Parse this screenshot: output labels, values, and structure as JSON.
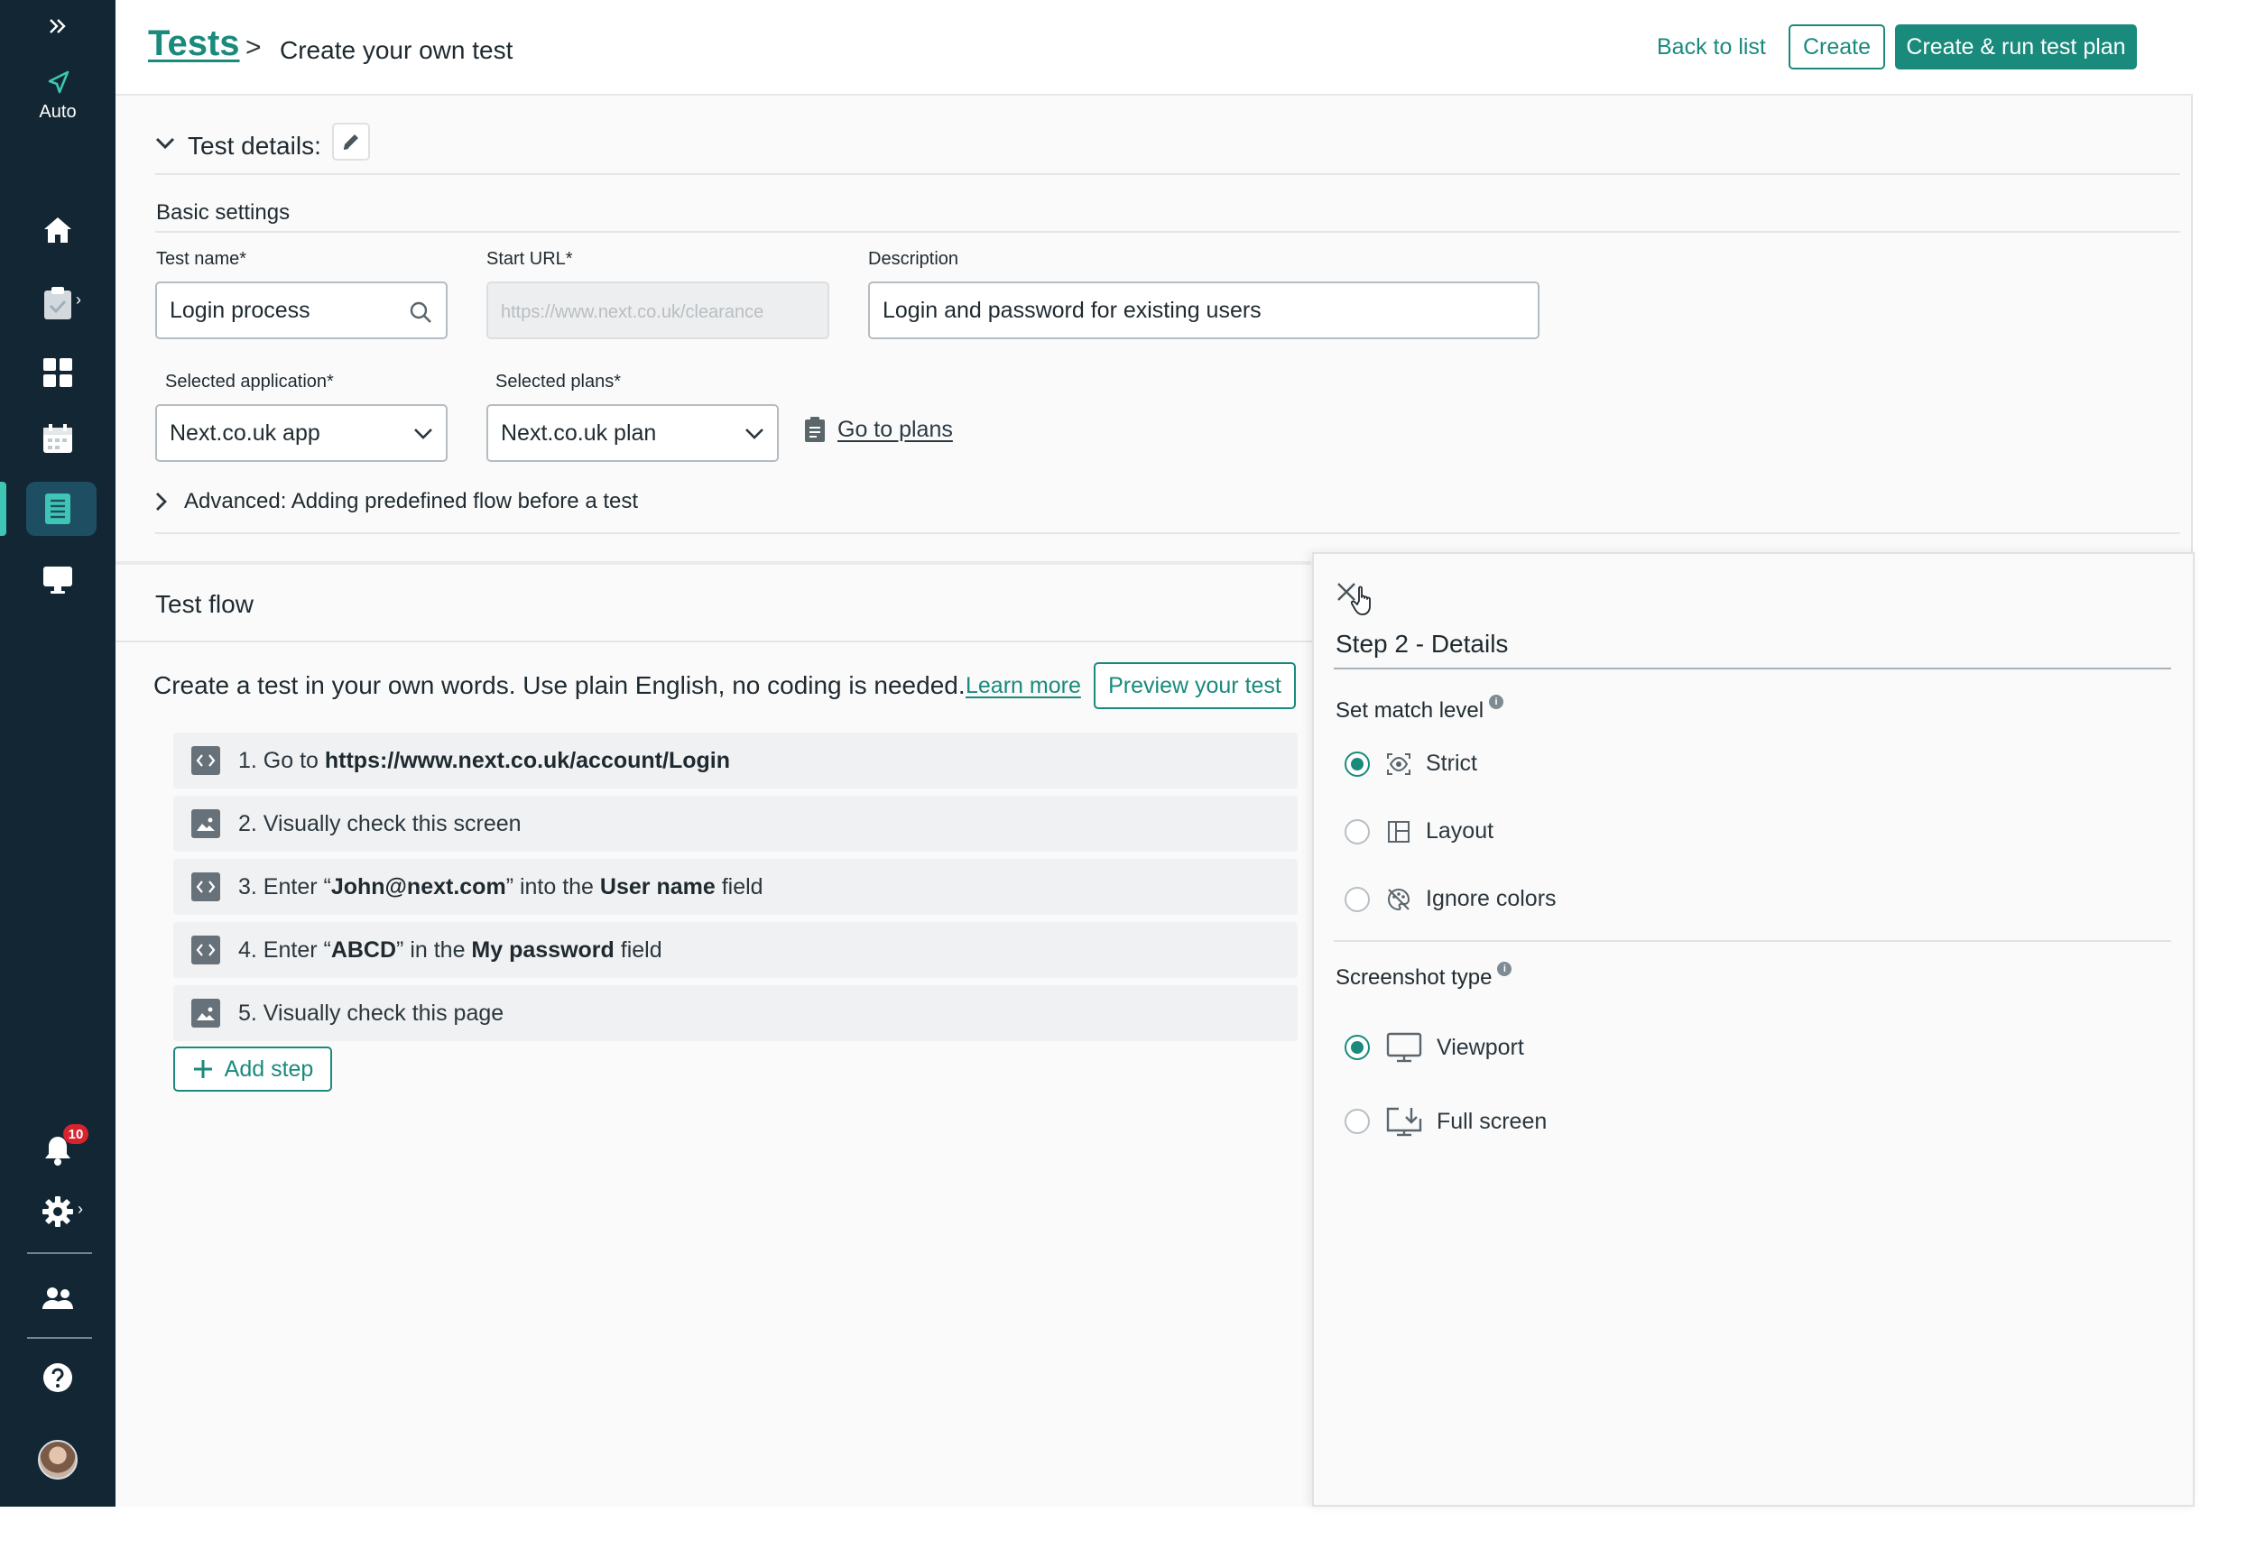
{
  "sidebar": {
    "auto_label": "Auto",
    "notification_count": "10",
    "accent_color": "#3fc5b4",
    "background_color": "#122733",
    "icons": [
      "expand-icon",
      "auto-logo-icon",
      "home-icon",
      "clipboard-check-icon",
      "dashboard-grid-icon",
      "calendar-icon",
      "test-list-icon",
      "monitor-icon",
      "bell-icon",
      "gear-icon",
      "users-icon",
      "help-icon"
    ]
  },
  "header": {
    "breadcrumb_root": "Tests",
    "breadcrumb_separator": ">",
    "breadcrumb_current": "Create your own test",
    "back_label": "Back to list",
    "create_label": "Create",
    "run_label": "Create & run test plan",
    "brand_color": "#1a8a7c"
  },
  "details": {
    "title": "Test details:",
    "basic_settings": "Basic settings",
    "test_name_label": "Test name*",
    "test_name_value": "Login process",
    "start_url_label": "Start URL*",
    "start_url_placeholder": "https://www.next.co.uk/clearance",
    "description_label": "Description",
    "description_value": "Login and password for existing users",
    "application_label": "Selected application*",
    "application_value": "Next.co.uk app",
    "plans_label": "Selected plans*",
    "plans_value": "Next.co.uk plan",
    "go_to_plans": "Go to plans",
    "advanced_label": "Advanced: Adding predefined flow before a test"
  },
  "flow": {
    "title": "Test flow",
    "intro": "Create a test in your own words. Use plain English, no coding is needed.",
    "learn_more": "Learn more",
    "preview_label": "Preview your test",
    "add_step_label": "Add step",
    "steps": [
      {
        "type": "code",
        "parts": [
          {
            "t": "1. Go to ",
            "b": false
          },
          {
            "t": "https://www.next.co.uk/account/Login",
            "b": true
          }
        ]
      },
      {
        "type": "image",
        "parts": [
          {
            "t": "2. Visually check this screen",
            "b": false
          }
        ]
      },
      {
        "type": "code",
        "parts": [
          {
            "t": "3. Enter “",
            "b": false
          },
          {
            "t": "John@next.com",
            "b": true
          },
          {
            "t": "” into the ",
            "b": false
          },
          {
            "t": "User name",
            "b": true
          },
          {
            "t": " field",
            "b": false
          }
        ]
      },
      {
        "type": "code",
        "parts": [
          {
            "t": "4. Enter “",
            "b": false
          },
          {
            "t": "ABCD",
            "b": true
          },
          {
            "t": "” in the ",
            "b": false
          },
          {
            "t": "My password",
            "b": true
          },
          {
            "t": " field",
            "b": false
          }
        ]
      },
      {
        "type": "image",
        "parts": [
          {
            "t": "5. Visually check this page",
            "b": false
          }
        ]
      }
    ]
  },
  "panel": {
    "title": "Step 2 - Details",
    "match_level_label": "Set match level",
    "match_options": [
      {
        "label": "Strict",
        "selected": true,
        "icon": "eye-scan-icon"
      },
      {
        "label": "Layout",
        "selected": false,
        "icon": "layout-icon"
      },
      {
        "label": "Ignore colors",
        "selected": false,
        "icon": "palette-off-icon"
      }
    ],
    "screenshot_type_label": "Screenshot type",
    "screenshot_options": [
      {
        "label": "Viewport",
        "selected": true,
        "icon": "monitor-icon"
      },
      {
        "label": "Full screen",
        "selected": false,
        "icon": "fullscreen-download-icon"
      }
    ]
  }
}
